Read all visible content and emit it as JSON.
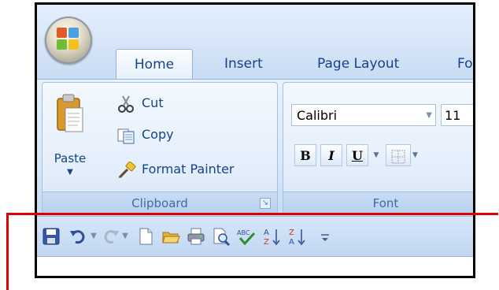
{
  "tabs": [
    {
      "label": "Home"
    },
    {
      "label": "Insert"
    },
    {
      "label": "Page Layout"
    },
    {
      "label": "Fo"
    }
  ],
  "clipboard": {
    "paste_label": "Paste",
    "cut_label": "Cut",
    "copy_label": "Copy",
    "format_painter_label": "Format Painter",
    "group_label": "Clipboard"
  },
  "font": {
    "font_name": "Calibri",
    "font_size": "11",
    "bold": "B",
    "italic": "I",
    "underline": "U",
    "group_label": "Font"
  },
  "quick_access_toolbar": {
    "items": [
      "save-icon",
      "undo-icon",
      "redo-icon",
      "new-document-icon",
      "open-icon",
      "quick-print-icon",
      "print-preview-icon",
      "spelling-icon",
      "sort-ascending-icon",
      "sort-descending-icon",
      "customize-toolbar-icon"
    ],
    "spelling_glyph": "ABC",
    "sort_asc_top": "A",
    "sort_asc_bottom": "Z",
    "sort_desc_top": "Z",
    "sort_desc_bottom": "A"
  },
  "colors": {
    "tab_text": "#15428b",
    "annotation": "#e00000",
    "ribbon_bg": "#dae8f8"
  }
}
